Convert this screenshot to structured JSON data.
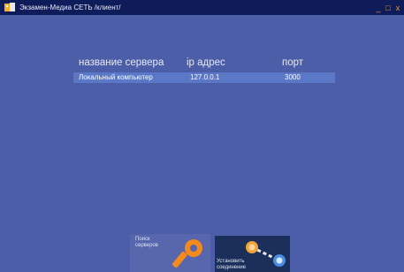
{
  "window": {
    "title": "Экзамен-Медиа СЕТЬ /клиент/",
    "controls": {
      "minimize": "_",
      "maximize": "□",
      "close": "x"
    }
  },
  "servers": {
    "headers": {
      "name": "название сервера",
      "ip": "ip адрес",
      "port": "порт"
    },
    "rows": [
      {
        "name": "Локальный компьютер",
        "ip": "127.0.0.1",
        "port": "3000"
      }
    ]
  },
  "buttons": {
    "search": {
      "label": "Поиск\nсерверов",
      "icon": "key-icon"
    },
    "connect": {
      "label": "Установить\nсоединение",
      "icon": "connection-nodes-icon"
    }
  },
  "colors": {
    "background": "#4c5ea8",
    "titlebar": "#0e1c5a",
    "row_highlight": "#5a78c6",
    "accent_orange": "#f28a1c",
    "connect_button_bg": "#1b2f5a"
  }
}
